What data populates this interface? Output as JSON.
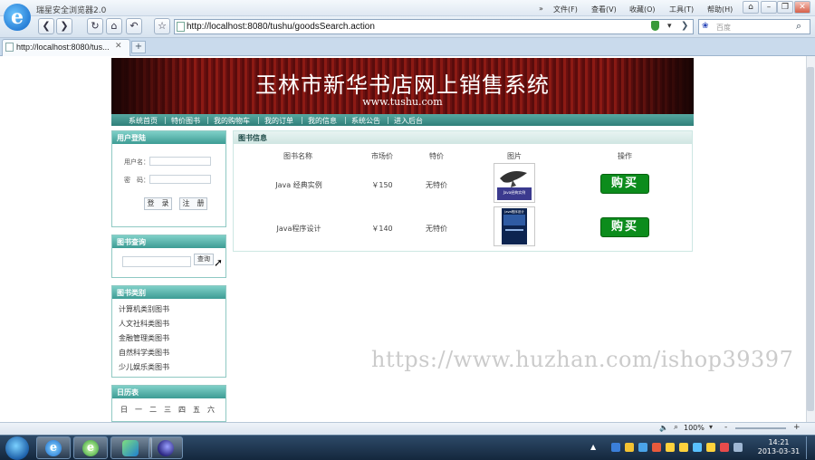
{
  "browser": {
    "app_title": "瑞星安全浏览器2.0",
    "menu": [
      "文件(F)",
      "查看(V)",
      "收藏(O)",
      "工具(T)",
      "帮助(H)"
    ],
    "address": "http://localhost:8080/tushu/goodsSearch.action",
    "search_placeholder": "百度",
    "tab_title": "http://localhost:8080/tus...",
    "zoom": "100%"
  },
  "site": {
    "title": "玉林市新华书店网上销售系统",
    "url": "www.tushu.com",
    "nav": [
      "系统首页",
      "特价图书",
      "我的购物车",
      "我的订单",
      "我的信息",
      "系统公告",
      "进入后台"
    ]
  },
  "login": {
    "heading": "用户登陆",
    "username_label": "用户名：",
    "password_label": "密　码：",
    "login_button": "登　录",
    "register_button": "注　册"
  },
  "search_panel": {
    "heading": "图书查询",
    "button": "查询"
  },
  "categories": {
    "heading": "图书类别",
    "items": [
      "计算机类别图书",
      "人文社科类图书",
      "金融管理类图书",
      "自然科学类图书",
      "少儿娱乐类图书"
    ]
  },
  "calendar": {
    "heading": "日历表",
    "weekdays": [
      "日",
      "一",
      "二",
      "三",
      "四",
      "五",
      "六"
    ]
  },
  "books": {
    "heading": "图书信息",
    "columns": [
      "图书名称",
      "市场价",
      "特价",
      "图片",
      "操作"
    ],
    "rows": [
      {
        "name": "Java 经典实例",
        "price": "￥150",
        "special": "无特价",
        "cover_title": "Java经典实例",
        "buy": "购买"
      },
      {
        "name": "Java程序设计",
        "price": "￥140",
        "special": "无特价",
        "cover_title": "Java程序设计",
        "buy": "购买"
      }
    ]
  },
  "watermark": "https://www.huzhan.com/ishop39397",
  "taskbar": {
    "time": "14:21",
    "date": "2013-03-31"
  },
  "colors": {
    "banner": "#6b1010",
    "teal": "#3d9c94",
    "buy": "#0c8c1c"
  }
}
